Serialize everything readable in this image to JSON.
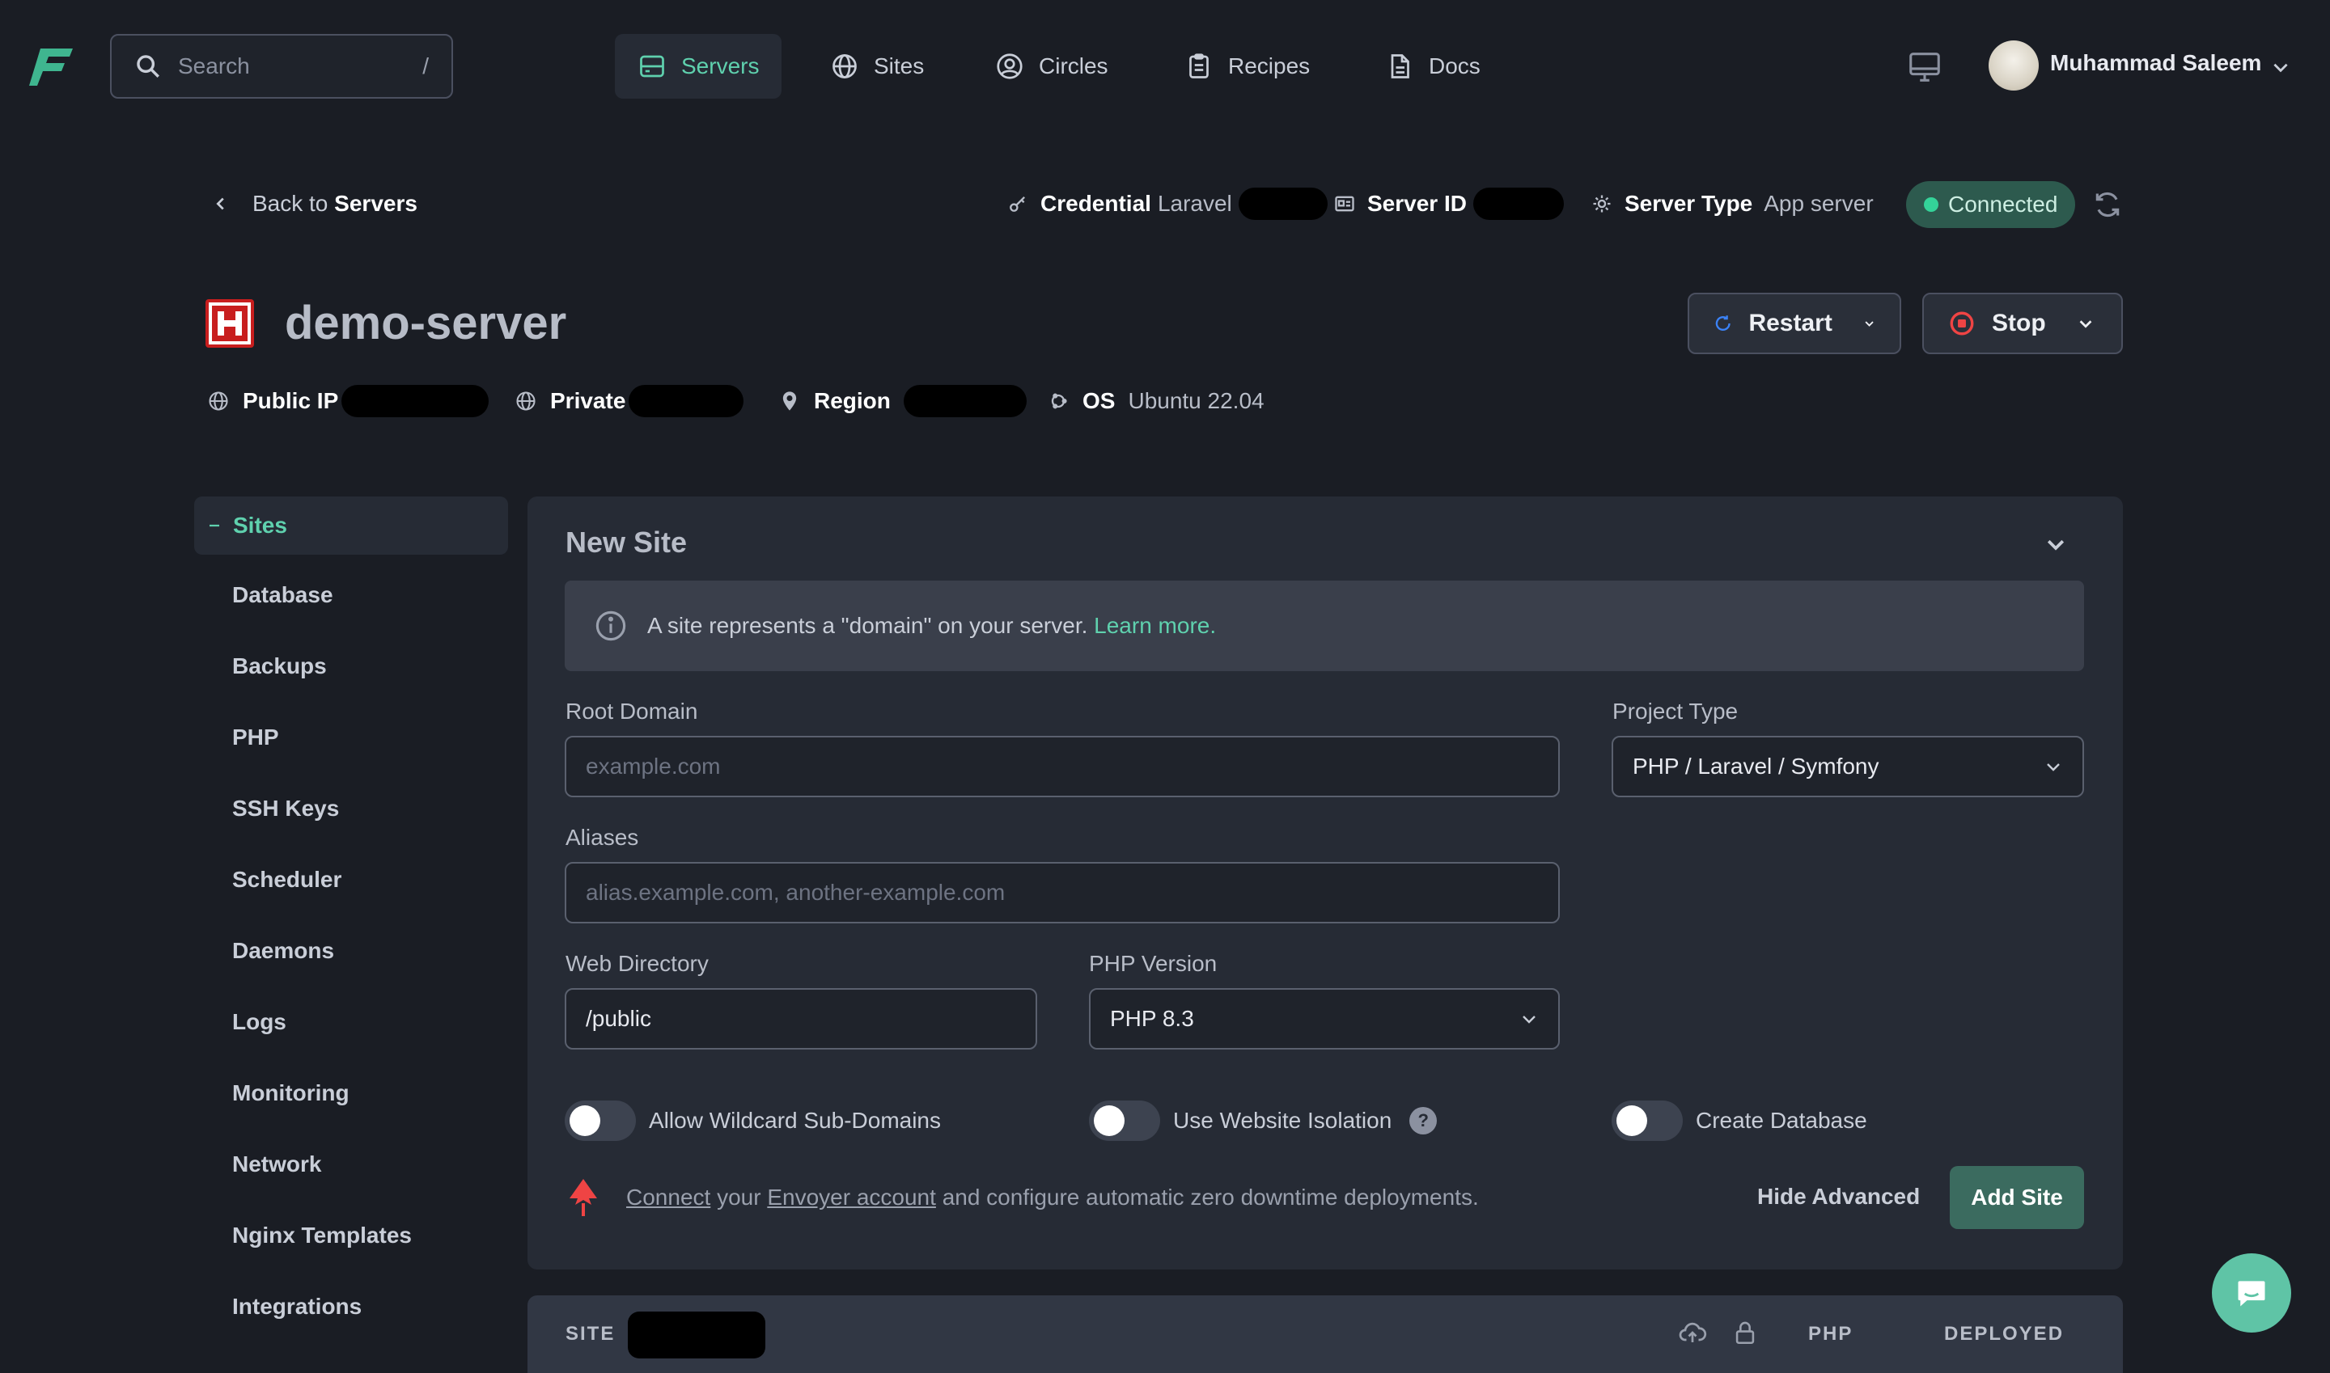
{
  "nav": {
    "search_placeholder": "Search",
    "search_shortcut": "/",
    "items": [
      {
        "label": "Servers",
        "icon": "server-icon",
        "active": true
      },
      {
        "label": "Sites",
        "icon": "globe-icon",
        "active": false
      },
      {
        "label": "Circles",
        "icon": "user-circle-icon",
        "active": false
      },
      {
        "label": "Recipes",
        "icon": "clipboard-icon",
        "active": false
      },
      {
        "label": "Docs",
        "icon": "document-icon",
        "active": false
      }
    ],
    "user_name": "Muhammad Saleem"
  },
  "server": {
    "back_prefix": "Back to",
    "back_target": "Servers",
    "credential_label": "Credential",
    "credential_value": "Laravel",
    "server_id_label": "Server ID",
    "server_type_label": "Server Type",
    "server_type_value": "App server",
    "status": "Connected",
    "name": "demo-server",
    "restart_label": "Restart",
    "stop_label": "Stop",
    "public_ip_label": "Public IP",
    "private_label": "Private",
    "region_label": "Region",
    "os_label": "OS",
    "os_value": "Ubuntu 22.04"
  },
  "sidebar": {
    "active": "Sites",
    "items": [
      "Database",
      "Backups",
      "PHP",
      "SSH Keys",
      "Scheduler",
      "Daemons",
      "Logs",
      "Monitoring",
      "Network",
      "Nginx Templates",
      "Integrations"
    ]
  },
  "new_site": {
    "title": "New Site",
    "info_text": "A site represents a \"domain\" on your server.",
    "info_link": "Learn more.",
    "root_domain_label": "Root Domain",
    "root_domain_placeholder": "example.com",
    "project_type_label": "Project Type",
    "project_type_value": "PHP / Laravel / Symfony",
    "aliases_label": "Aliases",
    "aliases_placeholder": "alias.example.com, another-example.com",
    "web_dir_label": "Web Directory",
    "web_dir_value": "/public",
    "php_version_label": "PHP Version",
    "php_version_value": "PHP 8.3",
    "toggle_wildcard": "Allow Wildcard Sub-Domains",
    "toggle_isolation": "Use Website Isolation",
    "toggle_database": "Create Database",
    "envoyer_connect": "Connect",
    "envoyer_your": "your",
    "envoyer_account": "Envoyer account",
    "envoyer_rest": "and configure automatic zero downtime deployments.",
    "hide_advanced": "Hide Advanced",
    "add_site": "Add Site"
  },
  "table": {
    "col_site": "SITE",
    "col_php": "PHP",
    "col_deployed": "DEPLOYED"
  },
  "colors": {
    "accent": "#5fd1ae",
    "background": "#1a1d24",
    "panel": "#262b35",
    "danger": "#c81e1e"
  }
}
